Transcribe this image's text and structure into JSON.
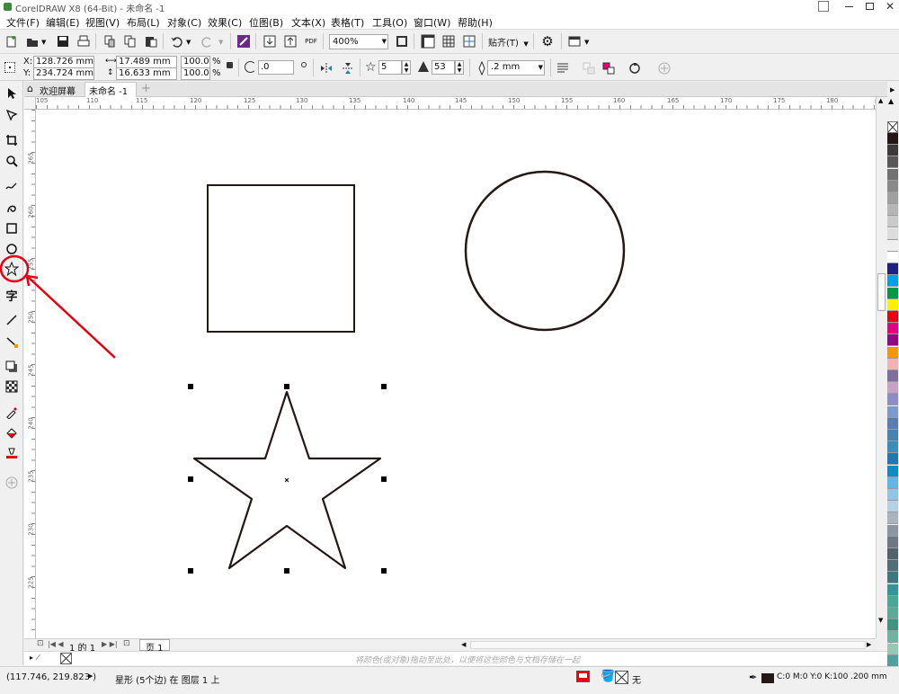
{
  "titlebar": {
    "title": "CorelDRAW X8 (64-Bit) - 未命名 -1"
  },
  "menu": [
    "文件(F)",
    "编辑(E)",
    "视图(V)",
    "布局(L)",
    "对象(C)",
    "效果(C)",
    "位图(B)",
    "文本(X)",
    "表格(T)",
    "工具(O)",
    "窗口(W)",
    "帮助(H)"
  ],
  "toolbar": {
    "zoom": "400%",
    "snap_label": "贴齐(T)",
    "pdf_label": "PDF"
  },
  "propbar": {
    "x_label": "X:",
    "x_value": "128.726 mm",
    "y_label": "Y:",
    "y_value": "234.724 mm",
    "w_value": "17.489 mm",
    "h_value": "16.633 mm",
    "scale_w": "100.0",
    "scale_h": "100.0",
    "pct": "%",
    "angle": ".0",
    "points": "5",
    "sharpness": "53",
    "outline": ".2 mm"
  },
  "tabs": {
    "welcome": "欢迎屏幕",
    "doc": "未命名 -1"
  },
  "ruler_h": [
    "105",
    "110",
    "115",
    "120",
    "125",
    "130",
    "135",
    "140",
    "145",
    "150",
    "155",
    "160",
    "165",
    "170",
    "175",
    "180"
  ],
  "ruler_v": [
    "265",
    "260",
    "255",
    "250",
    "245",
    "240",
    "235",
    "230",
    "225"
  ],
  "page_nav": {
    "count": "1 的 1",
    "page_tab": "页 1"
  },
  "hint": "将颜色(或对象)拖动至此处，以便将这些颜色与文档存储在一起",
  "status": {
    "coords": "(117.746, 219.823 )",
    "info": "星形 (5个边) 在 图层 1 上",
    "fill": "无",
    "outline_info": "C:0 M:0 Y:0 K:100  .200 mm"
  },
  "palette_colors": [
    "#231815",
    "#3e3a39",
    "#595757",
    "#727171",
    "#898989",
    "#9fa0a0",
    "#b5b5b6",
    "#c9caca",
    "#dcdddd",
    "#efefef",
    "#ffffff",
    "#1d2088",
    "#00a0e9",
    "#009944",
    "#fff100",
    "#e60012",
    "#e4007f",
    "#920783",
    "#f39800",
    "#f5b2b2",
    "#7d6e9c",
    "#c8a0c8",
    "#8c8cc8",
    "#7b9ad2",
    "#5a7db4",
    "#4682b4",
    "#3c8cbe",
    "#1e78b4",
    "#0a8cc8",
    "#64b4e6",
    "#8cc8e6",
    "#b4d2e6",
    "#aab4be",
    "#8c96a0",
    "#6e7882",
    "#50646e",
    "#506e78",
    "#3c7882",
    "#329696",
    "#46aa96",
    "#5aaa96",
    "#3c9682",
    "#6eb4a0",
    "#96c8b4",
    "#50a0a0"
  ]
}
